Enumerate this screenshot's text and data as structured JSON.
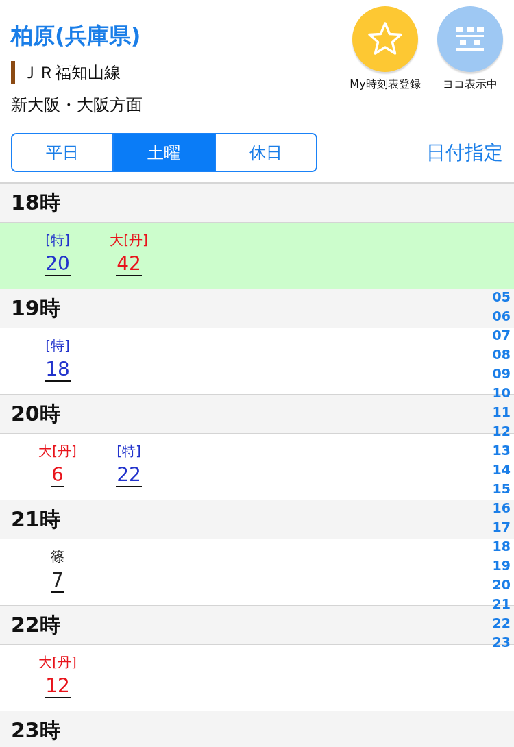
{
  "station": {
    "name": "柏原(兵庫県)",
    "line": "ＪＲ福知山線",
    "direction": "新大阪・大阪方面"
  },
  "actions": [
    {
      "kind": "favorite",
      "label": "My時刻表登録"
    },
    {
      "kind": "layout",
      "label": "ヨコ表示中"
    }
  ],
  "tabs": [
    {
      "label": "平日",
      "selected": false
    },
    {
      "label": "土曜",
      "selected": true
    },
    {
      "label": "休日",
      "selected": false
    }
  ],
  "date_link": "日付指定",
  "hours": [
    {
      "heading": "18時",
      "highlighted": true,
      "trains": [
        {
          "mark": "[特]",
          "minute": "20",
          "color": "#2233cc"
        },
        {
          "mark": "大[丹]",
          "minute": "42",
          "color": "#e8141c"
        }
      ]
    },
    {
      "heading": "19時",
      "highlighted": false,
      "trains": [
        {
          "mark": "[特]",
          "minute": "18",
          "color": "#2233cc"
        }
      ]
    },
    {
      "heading": "20時",
      "highlighted": false,
      "trains": [
        {
          "mark": "大[丹]",
          "minute": "6",
          "color": "#e8141c"
        },
        {
          "mark": "[特]",
          "minute": "22",
          "color": "#2233cc"
        }
      ]
    },
    {
      "heading": "21時",
      "highlighted": false,
      "trains": [
        {
          "mark": "篠",
          "minute": "7",
          "color": "#222222"
        }
      ]
    },
    {
      "heading": "22時",
      "highlighted": false,
      "trains": [
        {
          "mark": "大[丹]",
          "minute": "12",
          "color": "#e8141c"
        }
      ]
    },
    {
      "heading": "23時"
    }
  ],
  "hour_index": [
    "05",
    "06",
    "07",
    "08",
    "09",
    "10",
    "11",
    "12",
    "13",
    "14",
    "15",
    "16",
    "17",
    "18",
    "19",
    "20",
    "21",
    "22",
    "23"
  ]
}
